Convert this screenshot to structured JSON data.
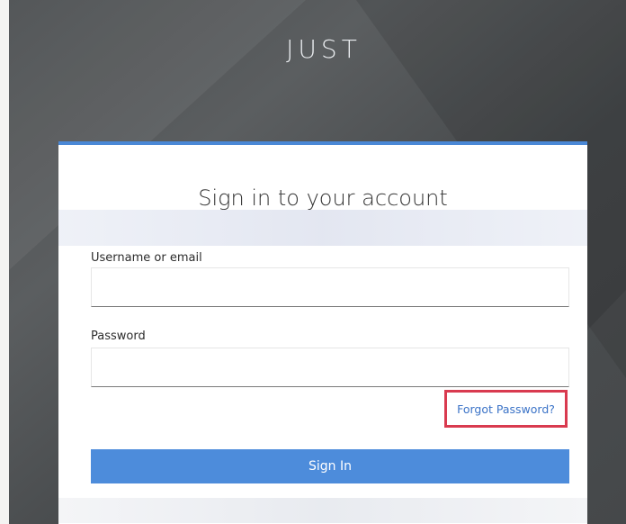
{
  "brand": {
    "title": "JUST"
  },
  "form": {
    "heading": "Sign in to your account",
    "username_label": "Username or email",
    "username_value": "",
    "password_label": "Password",
    "password_value": "",
    "forgot_link": "Forgot Password?",
    "signin_button": "Sign In"
  },
  "colors": {
    "accent": "#4d8cdb",
    "highlight_box": "#d93a4f",
    "link": "#3b73c7"
  }
}
